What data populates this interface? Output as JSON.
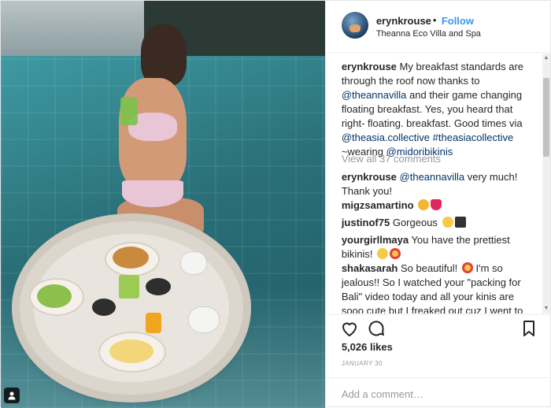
{
  "post": {
    "username": "erynkrouse",
    "separator": "•",
    "follow_label": "Follow",
    "location": "Theanna Eco Villa and Spa"
  },
  "caption": {
    "username": "erynkrouse",
    "text_1": " My breakfast standards are through the roof now thanks to ",
    "mention_1": "@theannavilla",
    "text_2": " and their game changing floating breakfast. Yes, you heard that right- floating. breakfast. Good times via ",
    "mention_2": "@theasia.collective",
    "text_3": " ",
    "hashtag_1": "#theasiacollective",
    "text_4": " ~wearing ",
    "mention_3": "@midoribikinis"
  },
  "view_all_comments": "View all 37 comments",
  "comments": [
    {
      "username": "erynkrouse",
      "mention": "@theannavilla",
      "text": " very much! Thank you!"
    },
    {
      "username": "migzsamartino",
      "text": " "
    },
    {
      "username": "justinof75",
      "text": " Gorgeous "
    },
    {
      "username": "yourgirllmaya",
      "text": " You have the prettiest bikinis! "
    },
    {
      "username": "shakasarah",
      "text": " So beautiful! ",
      "text_b": " I'm so jealous!! So I watched your \"packing for Bali\" video today and all your kinis are sooo cute but I freaked out cuz I went to Bali in"
    }
  ],
  "likes": "5,026 likes",
  "date": "JANUARY 30",
  "add_comment_placeholder": "Add a comment…",
  "icons": {
    "like": "heart-icon",
    "comment": "comment-icon",
    "save": "bookmark-icon",
    "user_tag": "user-tag-icon"
  },
  "colors": {
    "link": "#3897f0",
    "mention": "#003569",
    "muted": "#999999",
    "text": "#262626"
  }
}
